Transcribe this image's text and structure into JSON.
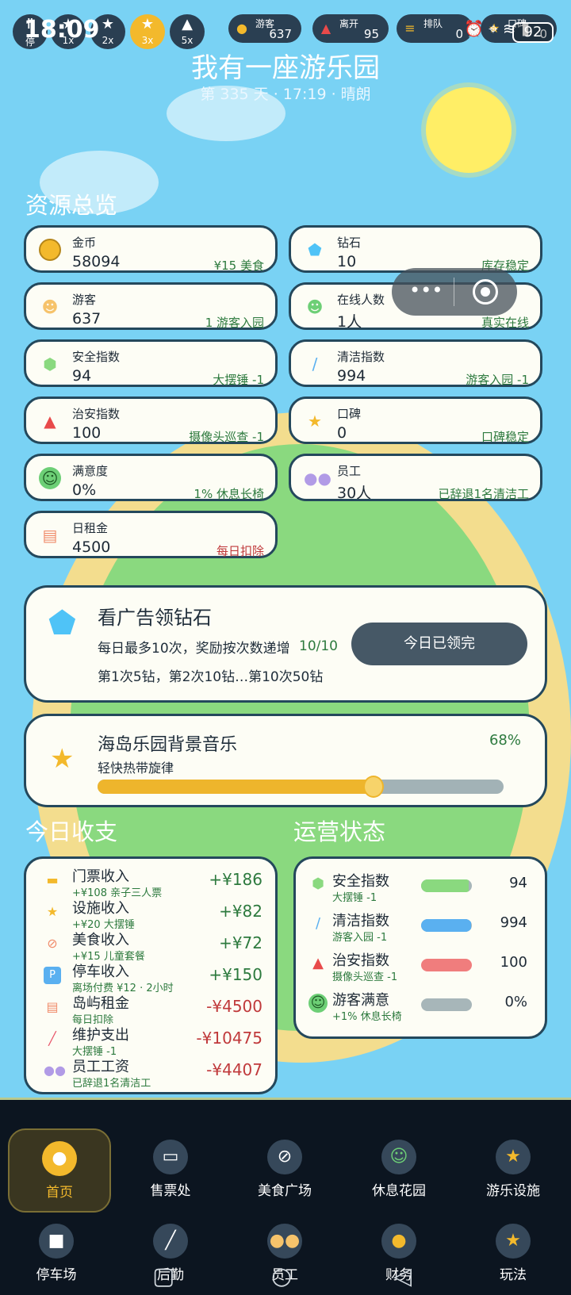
{
  "status_bar": {
    "time": "18:09",
    "battery": "92"
  },
  "speeds": [
    {
      "label": "停",
      "icon": "pause"
    },
    {
      "label": "1x",
      "icon": "star"
    },
    {
      "label": "2x",
      "icon": "star"
    },
    {
      "label": "3x",
      "icon": "star"
    },
    {
      "label": "5x",
      "icon": "warning"
    }
  ],
  "top_stats": [
    {
      "label": "游客",
      "value": "637",
      "icon": "person-icon"
    },
    {
      "label": "离开",
      "value": "95",
      "icon": "warning-icon"
    },
    {
      "label": "排队",
      "value": "0",
      "icon": "queue-icon"
    },
    {
      "label": "口碑",
      "value": "0",
      "icon": "star-icon"
    }
  ],
  "header": {
    "title": "我有一座游乐园",
    "subtitle": "第 335 天 · 17:19 · 晴朗"
  },
  "resources_title": "资源总览",
  "resources": [
    {
      "label": "金币",
      "value": "58094",
      "note": "¥15 美食",
      "icon": "coin-icon",
      "color": "#f3b92c"
    },
    {
      "label": "钻石",
      "value": "10",
      "note": "库存稳定",
      "icon": "diamond-icon",
      "color": "#4fc3f7"
    },
    {
      "label": "游客",
      "value": "637",
      "note": "1 游客入园",
      "icon": "visitor-icon",
      "color": "#f6c36b"
    },
    {
      "label": "在线人数",
      "value": "1人",
      "note": "真实在线",
      "icon": "online-user-icon",
      "color": "#6dcf76"
    },
    {
      "label": "安全指数",
      "value": "94",
      "note": "大摆锤 -1",
      "icon": "shield-icon",
      "color": "#8ad97f"
    },
    {
      "label": "清洁指数",
      "value": "994",
      "note": "游客入园 -1",
      "icon": "broom-icon",
      "color": "#5ab0f0"
    },
    {
      "label": "治安指数",
      "value": "100",
      "note": "摄像头巡查 -1",
      "icon": "alert-icon",
      "color": "#e84a4a"
    },
    {
      "label": "口碑",
      "value": "0",
      "note": "口碑稳定",
      "icon": "reputation-icon",
      "color": "#f3b92c"
    },
    {
      "label": "满意度",
      "value": "0%",
      "note": "1% 休息长椅",
      "icon": "smile-icon",
      "color": "#6dcf76"
    },
    {
      "label": "员工",
      "value": "30人",
      "note": "已辞退1名清洁工",
      "icon": "staff-icon",
      "color": "#b19be6"
    },
    {
      "label": "日租金",
      "value": "4500",
      "note": "每日扣除",
      "icon": "rent-icon",
      "color": "#f08b6a"
    }
  ],
  "ad_panel": {
    "title": "看广告领钻石",
    "line1": "每日最多10次，奖励按次数递增",
    "count": "10/10",
    "line2": "第1次5钻，第2次10钻…第10次50钻",
    "button": "今日已领完"
  },
  "music_panel": {
    "title": "海岛乐园背景音乐",
    "subtitle": "轻快热带旋律",
    "percent_label": "68%",
    "volume": 0.68
  },
  "income_title": "今日收支",
  "ops_title": "运营状态",
  "ledger": [
    {
      "title": "门票收入",
      "sub": "+¥108 亲子三人票",
      "amount": "+¥186",
      "icon": "ticket-icon"
    },
    {
      "title": "设施收入",
      "sub": "+¥20 大摆锤",
      "amount": "+¥82",
      "icon": "ride-icon"
    },
    {
      "title": "美食收入",
      "sub": "+¥15 儿童套餐",
      "amount": "+¥72",
      "icon": "food-icon"
    },
    {
      "title": "停车收入",
      "sub": "离场付费 ¥12 · 2小时",
      "amount": "+¥150",
      "icon": "parking-icon"
    },
    {
      "title": "岛屿租金",
      "sub": "每日扣除",
      "amount": "-¥4500",
      "icon": "rent-icon"
    },
    {
      "title": "维护支出",
      "sub": "大摆锤 -1",
      "amount": "-¥10475",
      "icon": "wrench-icon"
    },
    {
      "title": "员工工资",
      "sub": "已辞退1名清洁工",
      "amount": "-¥4407",
      "icon": "staff-icon"
    }
  ],
  "ops": [
    {
      "title": "安全指数",
      "sub": "大摆锤 -1",
      "value": "94",
      "level": 0.94,
      "color": "#8ad97f",
      "icon": "shield-icon"
    },
    {
      "title": "清洁指数",
      "sub": "游客入园 -1",
      "value": "994",
      "level": 0.99,
      "color": "#5ab0f0",
      "icon": "broom-icon"
    },
    {
      "title": "治安指数",
      "sub": "摄像头巡查 -1",
      "value": "100",
      "level": 1.0,
      "color": "#f07d7d",
      "icon": "alert-icon"
    },
    {
      "title": "游客满意",
      "sub": "+1% 休息长椅",
      "value": "0%",
      "level": 0.0,
      "color": "#8ad97f",
      "icon": "smile-icon"
    }
  ],
  "nav": [
    {
      "label": "首页",
      "icon": "coin-icon"
    },
    {
      "label": "售票处",
      "icon": "ticket-icon"
    },
    {
      "label": "美食广场",
      "icon": "food-icon"
    },
    {
      "label": "休息花园",
      "icon": "smile-icon"
    },
    {
      "label": "游乐设施",
      "icon": "ride-icon"
    },
    {
      "label": "停车场",
      "icon": "parking-icon"
    },
    {
      "label": "后勤",
      "icon": "wrench-icon"
    },
    {
      "label": "员工",
      "icon": "staff-icon"
    },
    {
      "label": "财务",
      "icon": "coin-icon"
    },
    {
      "label": "玩法",
      "icon": "ride-icon"
    }
  ]
}
